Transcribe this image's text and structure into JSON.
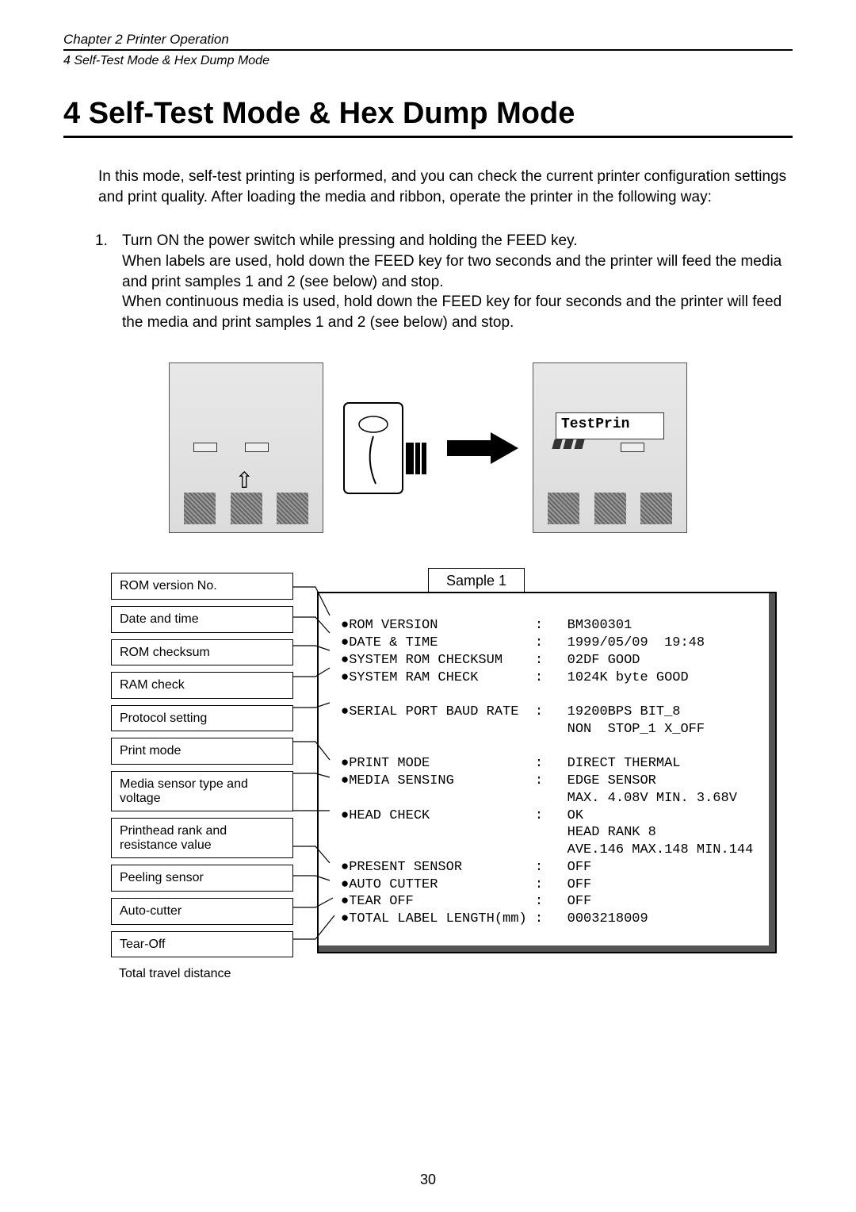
{
  "header": {
    "chapter": "Chapter 2   Printer Operation",
    "breadcrumb": "4   Self-Test Mode & Hex Dump Mode"
  },
  "heading": "4  Self-Test Mode & Hex Dump Mode",
  "intro": "In this mode, self-test printing is performed, and you can check the current printer configuration settings and print quality. After loading the media and ribbon, operate the printer in the following way:",
  "step": {
    "num": "1.",
    "lines": [
      "Turn ON the power switch while pressing and holding the FEED key.",
      "When labels are used, hold down the FEED key for two seconds and the printer will feed the media and print samples 1 and 2 (see below) and stop.",
      "When continuous media is used, hold down the FEED key for four seconds and the printer will feed the media and print samples 1 and 2 (see below) and stop."
    ]
  },
  "lcd_text": "TestPrin",
  "sample_badge": "Sample 1",
  "labels": [
    "ROM version No.",
    "Date and time",
    "ROM checksum",
    "RAM check",
    "Protocol setting",
    "Print mode",
    "Media sensor type and voltage",
    "Printhead rank and resistance value",
    "Peeling sensor",
    "Auto-cutter",
    "Tear-Off",
    "Total travel distance"
  ],
  "printout": {
    "rom_version": {
      "k": "ROM VERSION",
      "v": "BM300301"
    },
    "date_time": {
      "k": "DATE & TIME",
      "v": "1999/05/09  19:48"
    },
    "rom_checksum": {
      "k": "SYSTEM ROM CHECKSUM",
      "v": "02DF GOOD"
    },
    "ram_check": {
      "k": "SYSTEM RAM CHECK",
      "v": "1024K byte GOOD"
    },
    "serial": {
      "k": "SERIAL PORT BAUD RATE",
      "v": "19200BPS BIT_8"
    },
    "serial2": {
      "v": "NON  STOP_1 X_OFF"
    },
    "print_mode": {
      "k": "PRINT MODE",
      "v": "DIRECT THERMAL"
    },
    "media_sensing": {
      "k": "MEDIA SENSING",
      "v": "EDGE SENSOR"
    },
    "media_sensing2": {
      "v": "MAX. 4.08V MIN. 3.68V"
    },
    "head_check": {
      "k": "HEAD CHECK",
      "v": "OK"
    },
    "head_rank": {
      "v": "HEAD RANK 8"
    },
    "head_res": {
      "v": "AVE.146 MAX.148 MIN.144"
    },
    "present_sensor": {
      "k": "PRESENT SENSOR",
      "v": "OFF"
    },
    "auto_cutter": {
      "k": "AUTO CUTTER",
      "v": "OFF"
    },
    "tear_off": {
      "k": "TEAR OFF",
      "v": "OFF"
    },
    "total_len": {
      "k": "TOTAL LABEL LENGTH(mm)",
      "v": "0003218009"
    }
  },
  "page_number": "30"
}
